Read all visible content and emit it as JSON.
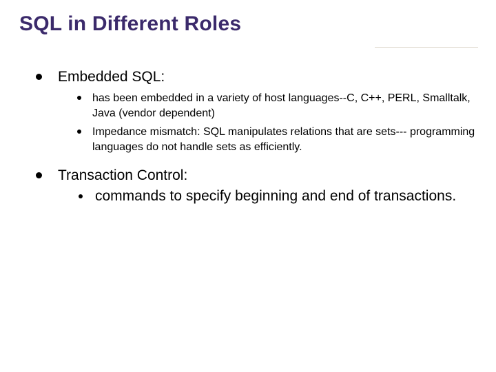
{
  "title": "SQL in Different Roles",
  "items": [
    {
      "label": "Embedded SQL:",
      "sub_small": [
        "has been  embedded in a variety of  host languages--C, C++, PERL, Smalltalk, Java  (vendor dependent)",
        "Impedance mismatch: SQL manipulates relations that are sets--- programming languages do not handle sets as efficiently."
      ]
    },
    {
      "label": "Transaction Control:",
      "sub_large": [
        "commands to specify beginning and end of transactions."
      ]
    }
  ]
}
